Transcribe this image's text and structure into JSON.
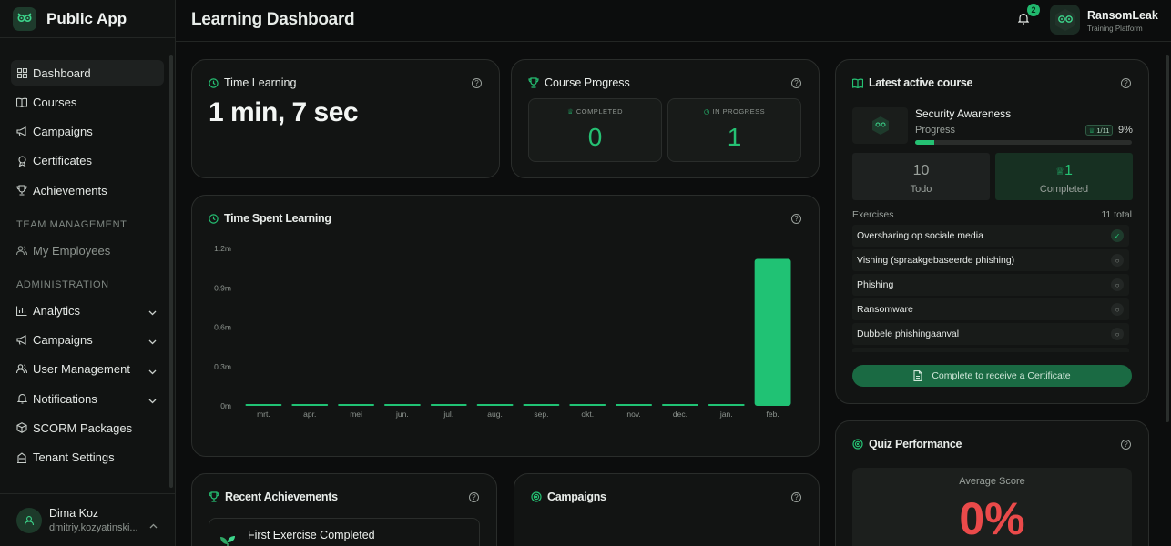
{
  "app": {
    "name": "Public App"
  },
  "sidebar": {
    "items": [
      {
        "label": "Dashboard",
        "icon": "grid-icon",
        "active": true
      },
      {
        "label": "Courses",
        "icon": "book-icon"
      },
      {
        "label": "Campaigns",
        "icon": "megaphone-icon"
      },
      {
        "label": "Certificates",
        "icon": "award-icon"
      },
      {
        "label": "Achievements",
        "icon": "trophy-icon"
      }
    ],
    "team_section": "TEAM MANAGEMENT",
    "team_items": [
      {
        "label": "My Employees",
        "icon": "users-icon"
      }
    ],
    "admin_section": "ADMINISTRATION",
    "admin_items": [
      {
        "label": "Analytics",
        "icon": "bar-chart-icon",
        "expandable": true
      },
      {
        "label": "Campaigns",
        "icon": "megaphone-icon",
        "expandable": true
      },
      {
        "label": "User Management",
        "icon": "users-icon",
        "expandable": true
      },
      {
        "label": "Notifications",
        "icon": "bell-icon",
        "expandable": true
      },
      {
        "label": "SCORM Packages",
        "icon": "package-icon"
      },
      {
        "label": "Tenant Settings",
        "icon": "building-icon"
      }
    ]
  },
  "user": {
    "name": "Dima Koz",
    "email": "dmitriy.kozyatinski..."
  },
  "header": {
    "title": "Learning Dashboard",
    "notification_count": "2",
    "org_name": "RansomLeak",
    "org_subtitle": "Training Platform"
  },
  "time_learning": {
    "title": "Time Learning",
    "value": "1 min, 7 sec"
  },
  "course_progress": {
    "title": "Course Progress",
    "completed_label": "COMPLETED",
    "completed_value": "0",
    "in_progress_label": "IN PROGRESS",
    "in_progress_value": "1"
  },
  "time_spent": {
    "title": "Time Spent Learning"
  },
  "chart_data": {
    "type": "bar",
    "categories": [
      "mrt.",
      "apr.",
      "mei",
      "jun.",
      "jul.",
      "aug.",
      "sep.",
      "okt.",
      "nov.",
      "dec.",
      "jan.",
      "feb."
    ],
    "values": [
      0,
      0,
      0,
      0,
      0,
      0,
      0,
      0,
      0,
      0,
      0,
      1.12
    ],
    "y_ticks": [
      "0m",
      "0.3m",
      "0.6m",
      "0.9m",
      "1.2m"
    ],
    "ylim": [
      0,
      1.2
    ],
    "ylabel_unit": "m",
    "grid": false,
    "bar_color": "#20c274"
  },
  "latest_course": {
    "title": "Latest active course",
    "course_name": "Security Awareness",
    "progress_label": "Progress",
    "exercise_pill": "1/11",
    "percent_text": "9%",
    "progress_fraction": 0.09,
    "todo_value": "10",
    "todo_label": "Todo",
    "completed_value": "1",
    "completed_label": "Completed",
    "exercises_label": "Exercises",
    "exercises_total": "11 total",
    "exercises": [
      {
        "name": "Oversharing op sociale media",
        "done": true
      },
      {
        "name": "Vishing (spraakgebaseerde phishing)",
        "done": false
      },
      {
        "name": "Phishing",
        "done": false
      },
      {
        "name": "Ransomware",
        "done": false
      },
      {
        "name": "Dubbele phishingaanval",
        "done": false
      }
    ],
    "certificate_button": "Complete to receive a Certificate"
  },
  "quiz": {
    "title": "Quiz Performance",
    "avg_label": "Average Score",
    "avg_value": "0%"
  },
  "recent_achievements": {
    "title": "Recent Achievements",
    "item_title": "First Exercise Completed"
  },
  "campaigns": {
    "title": "Campaigns"
  },
  "colors": {
    "accent": "#25c173",
    "danger": "#ea4a4a",
    "bg": "#0c0d0d",
    "card": "#121413"
  }
}
